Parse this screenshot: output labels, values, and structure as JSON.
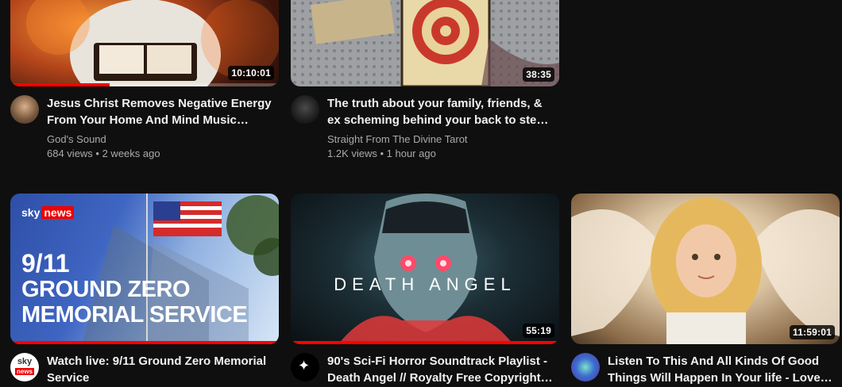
{
  "videos": [
    {
      "title": "Jesus Christ Removes Negative Energy From Your Home And Mind Music…",
      "channel": "God's Sound",
      "stats": "684 views • 2 weeks ago",
      "duration": "10:10:01",
      "progress_fraction": 0.37
    },
    {
      "title": "The truth about your family, friends, & ex scheming behind your back to ste…",
      "channel": "Straight From The Divine Tarot",
      "stats": "1.2K views • 1 hour ago",
      "duration": "38:35"
    },
    {
      "title": "Watch live: 9/11 Ground Zero Memorial Service",
      "duration": "",
      "progress_fraction": 1.0,
      "thumb_brand": "sky",
      "thumb_brand2": "news",
      "thumb_line1": "9/11",
      "thumb_line2": "GROUND ZERO",
      "thumb_line3": "MEMORIAL SERVICE",
      "avatar_text1": "sky",
      "avatar_text2": "news"
    },
    {
      "title": "90's Sci-Fi Horror Soundtrack Playlist - Death Angel // Royalty Free Copyright…",
      "duration": "55:19",
      "progress_fraction": 1.0,
      "thumb_text": "DEATH ANGEL"
    },
    {
      "title": "Listen To This And All Kinds Of Good Things Will Happen In Your life - Love…",
      "duration": "11:59:01"
    }
  ],
  "colors": {
    "background": "#0f0f0f",
    "progress": "#ff0000",
    "secondary_text": "#aaaaaa"
  }
}
